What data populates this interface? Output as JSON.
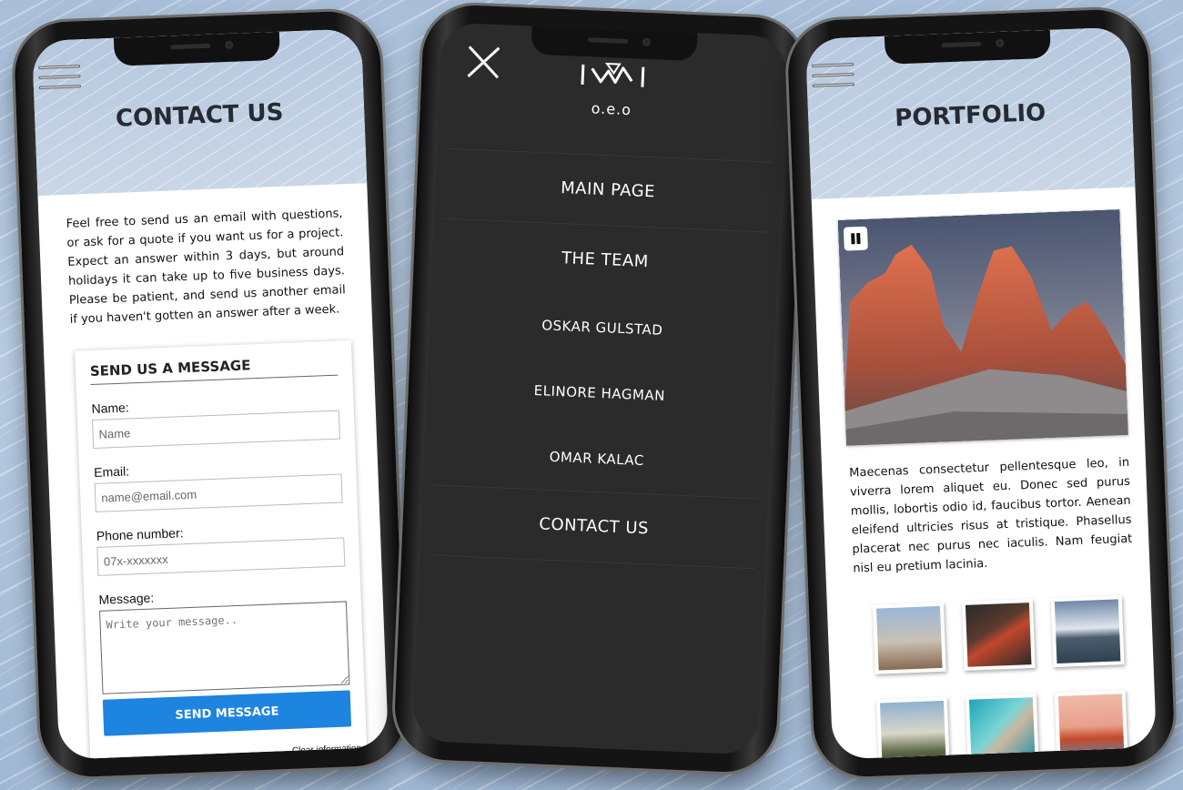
{
  "contact_phone": {
    "title": "CONTACT US",
    "intro": "Feel free to send us an email with questions, or ask for a quote if you want us for a project. Expect an answer within 3 days, but around holidays it can take up to five business days. Please be patient, and send us another email if you haven't gotten an answer after a week.",
    "form": {
      "title": "SEND US A MESSAGE",
      "name_label": "Name:",
      "name_placeholder": "Name",
      "email_label": "Email:",
      "email_placeholder": "name@email.com",
      "phone_label": "Phone number:",
      "phone_placeholder": "07x-xxxxxxx",
      "message_label": "Message:",
      "message_placeholder": "Write your message..",
      "send_label": "SEND MESSAGE",
      "clear_label": "Clear information"
    }
  },
  "menu_phone": {
    "logo_text": "o.e.o",
    "items": [
      "MAIN PAGE",
      "THE TEAM",
      "OSKAR GULSTAD",
      "ELINORE HAGMAN",
      "OMAR KALAC",
      "CONTACT US"
    ]
  },
  "portfolio_phone": {
    "title": "PORTFOLIO",
    "text": "Maecenas consectetur pellentesque leo, in viverra lorem aliquet eu. Donec sed purus mollis, lobortis odio id, faucibus tortor. Aenean eleifend ultricies risus at tristique. Phasellus placerat nec purus nec iaculis. Nam feugiat nisl eu pretium lacinia.",
    "thumbnails": [
      "hot-air-balloons",
      "volcano",
      "snowy-mountains",
      "misty-field",
      "coastline",
      "golden-gate-bridge"
    ]
  },
  "colors": {
    "accent": "#1d84e0",
    "menu_bg": "#2b2b2b"
  }
}
